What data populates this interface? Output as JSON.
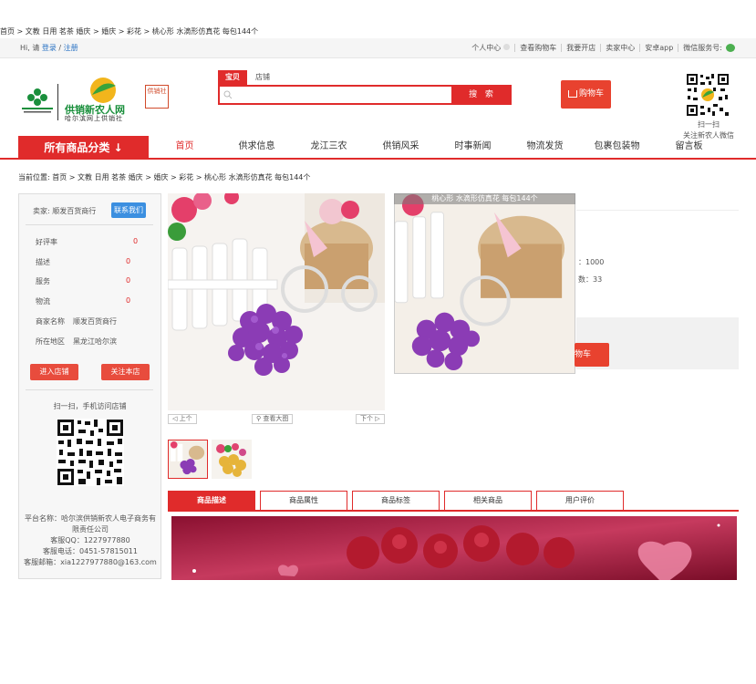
{
  "top_breadcrumb": "首页 > 文教 日用 茗茶 婚庆 > 婚庆 > 彩花 > 桃心形 水滴形仿真花 每包144个",
  "topbar": {
    "greeting": "Hi, 请",
    "login": "登录",
    "slash": "/",
    "register": "注册",
    "links": [
      "个人中心",
      "查看购物车",
      "我要开店",
      "卖家中心",
      "安卓app",
      "微信服务号:"
    ]
  },
  "header": {
    "logo_text": "供销新农人网",
    "logo_sub": "哈尔滨网上供销社",
    "badge_text": "供销社",
    "search_tabs": [
      "宝贝",
      "店铺"
    ],
    "search_placeholder": "",
    "search_button": "搜 索",
    "cart_button": "购物车",
    "qr_caption_1": "扫一扫",
    "qr_caption_2": "关注新农人微信"
  },
  "nav": {
    "all_categories": "所有商品分类 ↓",
    "items": [
      "首页",
      "供求信息",
      "龙江三农",
      "供销风采",
      "时事新闻",
      "物流发货",
      "包裹包装物",
      "留言板"
    ]
  },
  "breadcrumb": "当前位置: 首页 > 文教 日用 茗茶 婚庆 > 婚庆 > 彩花 > 桃心形 水滴形仿真花 每包144个",
  "seller": {
    "label": "卖家:  顺发百货商行",
    "contact_button": "联系我们",
    "ratings": [
      {
        "label": "好评率",
        "value": "0"
      },
      {
        "label": "描述",
        "value": "0"
      },
      {
        "label": "服务",
        "value": "0"
      },
      {
        "label": "物流",
        "value": "0"
      }
    ],
    "shop_name_label": "商家名称",
    "shop_name": "顺发百货商行",
    "region_label": "所在地区",
    "region": "黑龙江哈尔滨",
    "enter_shop": "进入店铺",
    "follow_shop": "关注本店",
    "scan_text": "扫一扫，手机访问店铺",
    "platform_lines": [
      "平台名称：哈尔滨供销新农人电子商务有限责任公司",
      "客服QQ：1227977880",
      "客服电话：0451-57815011",
      "客服邮箱：xia1227977880@163.com"
    ]
  },
  "product": {
    "zoom_title": "桃心形 水滴形仿真花 每包144个",
    "prev": "上个",
    "view_large": "查看大图",
    "next": "下个",
    "stock_text": "：1000",
    "sold_text": "数：33",
    "add_cart": "物车"
  },
  "tabs": [
    "商品描述",
    "商品属性",
    "商品标签",
    "相关商品",
    "用户评价"
  ]
}
